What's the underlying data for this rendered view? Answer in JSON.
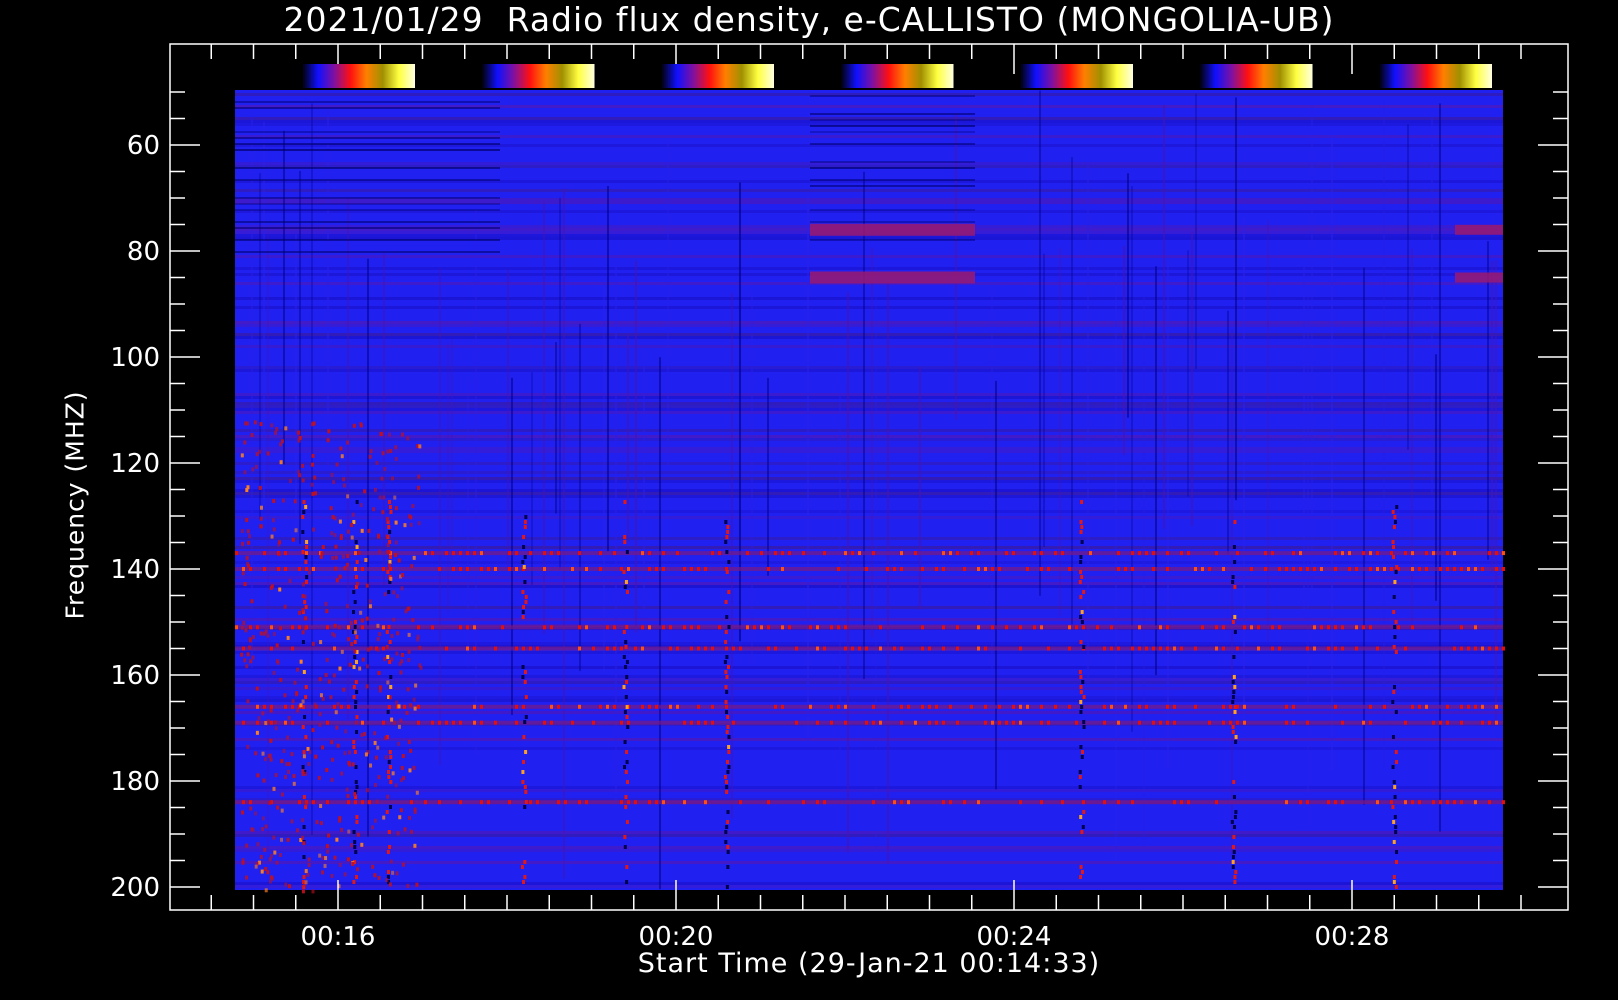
{
  "chart_data": {
    "type": "heatmap",
    "title": "2021/01/29  Radio flux density, e-CALLISTO (MONGOLIA-UB)",
    "xlabel": "Start Time (29-Jan-21 00:14:33)",
    "ylabel": "Frequency (MHZ)",
    "x_ticks": [
      "00:16",
      "00:20",
      "00:24",
      "00:28"
    ],
    "x_tick_minutes": [
      16,
      20,
      24,
      28
    ],
    "x_range_minutes": [
      14.55,
      29.7
    ],
    "y_ticks": [
      60,
      80,
      100,
      120,
      140,
      160,
      180,
      200
    ],
    "y_range": [
      200,
      50
    ],
    "y_axis_inverted": true,
    "colorbar_count": 7,
    "colormap": [
      "#000000",
      "#0000ff",
      "#ff0000",
      "#ffff00",
      "#ffffff"
    ],
    "background_color": "#2020f0",
    "bright_bands_mhz": [
      137,
      140,
      151,
      155,
      166,
      169,
      184
    ],
    "hot_bands_mhz": [
      76,
      85
    ],
    "burst_columns_minutes": [
      15.6,
      16.2,
      16.6,
      18.2,
      19.4,
      20.6,
      24.8,
      26.6,
      28.5
    ]
  }
}
